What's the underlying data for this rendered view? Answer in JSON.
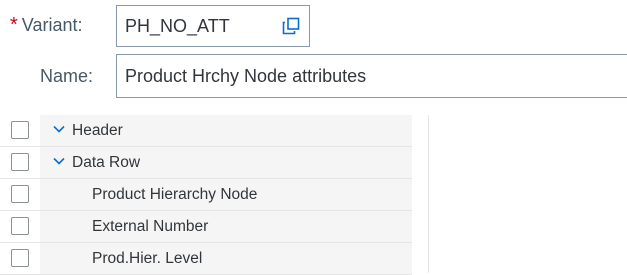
{
  "form": {
    "variant_label": "Variant:",
    "variant_value": "PH_NO_ATT",
    "name_label": "Name:",
    "name_value": "Product Hrchy Node attributes"
  },
  "icons": {
    "required": "required-asterisk",
    "copy": "copy-icon",
    "expand": "chevron-down-icon"
  },
  "colors": {
    "required": "#d0021b",
    "chevron": "#0a6ed1",
    "label": "#475866"
  },
  "tree": {
    "rows": [
      {
        "label": "Header",
        "expanded": true
      },
      {
        "label": "Data Row",
        "expanded": true
      },
      {
        "label": "Product Hierarchy Node"
      },
      {
        "label": "External Number"
      },
      {
        "label": "Prod.Hier. Level"
      }
    ]
  }
}
